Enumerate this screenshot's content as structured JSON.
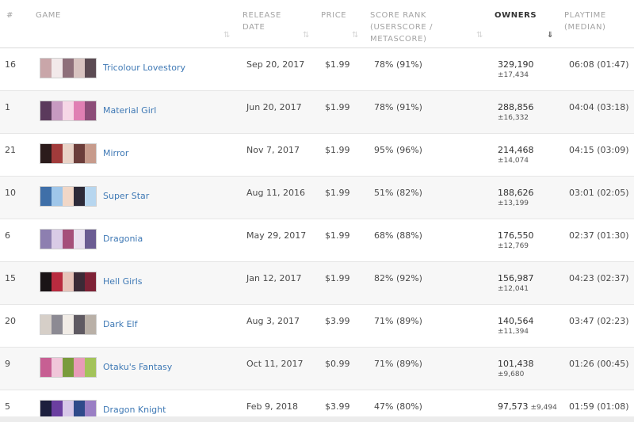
{
  "headers": {
    "num": "#",
    "game": "GAME",
    "release_1": "RELEASE",
    "release_2": "DATE",
    "price": "PRICE",
    "score_1": "SCORE RANK",
    "score_2": "(USERSCORE /",
    "score_3": "METASCORE)",
    "owners": "OWNERS",
    "playtime_1": "PLAYTIME",
    "playtime_2": "(MEDIAN)"
  },
  "icons": {
    "sort": "sort-arrows-icon",
    "sort_active": "sort-desc-icon",
    "sort_glyph": "⇅",
    "sort_active_glyph": "⇓"
  },
  "rows": [
    {
      "num": "16",
      "name": "Tricolour Lovestory",
      "date": "Sep 20, 2017",
      "price": "$1.99",
      "score": "78% (91%)",
      "owners": "329,190",
      "err": "±17,434",
      "play": "06:08 (01:47)",
      "thumb": [
        "#c9a6a9",
        "#f2e9ea",
        "#8e6f7a",
        "#d8c3c0",
        "#5b4a52"
      ]
    },
    {
      "num": "1",
      "name": "Material Girl",
      "date": "Jun 20, 2017",
      "price": "$1.99",
      "score": "78% (91%)",
      "owners": "288,856",
      "err": "±16,332",
      "play": "04:04 (03:18)",
      "thumb": [
        "#5b3a5c",
        "#c79ac1",
        "#f6d7e6",
        "#e07fb3",
        "#8c4d78"
      ]
    },
    {
      "num": "21",
      "name": "Mirror",
      "date": "Nov 7, 2017",
      "price": "$1.99",
      "score": "95% (96%)",
      "owners": "214,468",
      "err": "±14,074",
      "play": "04:15 (03:09)",
      "thumb": [
        "#2b1b1b",
        "#a13b3b",
        "#e9d3c7",
        "#6b3d3a",
        "#c79b8c"
      ]
    },
    {
      "num": "10",
      "name": "Super Star",
      "date": "Aug 11, 2016",
      "price": "$1.99",
      "score": "51% (82%)",
      "owners": "188,626",
      "err": "±13,199",
      "play": "03:01 (02:05)",
      "thumb": [
        "#3f6fa8",
        "#9fc6e9",
        "#f1d7c7",
        "#2d2a38",
        "#b7d6ef"
      ]
    },
    {
      "num": "6",
      "name": "Dragonia",
      "date": "May 29, 2017",
      "price": "$1.99",
      "score": "68% (88%)",
      "owners": "176,550",
      "err": "±12,769",
      "play": "02:37 (01:30)",
      "thumb": [
        "#8d7fb0",
        "#d9cbe6",
        "#a54f7a",
        "#e8dfef",
        "#6b5c92"
      ]
    },
    {
      "num": "15",
      "name": "Hell Girls",
      "date": "Jan 12, 2017",
      "price": "$1.99",
      "score": "82% (92%)",
      "owners": "156,987",
      "err": "±12,041",
      "play": "04:23 (02:37)",
      "thumb": [
        "#1a1416",
        "#b82b3f",
        "#e6c3b9",
        "#3b2a36",
        "#7e2236"
      ]
    },
    {
      "num": "20",
      "name": "Dark Elf",
      "date": "Aug 3, 2017",
      "price": "$3.99",
      "score": "71% (89%)",
      "owners": "140,564",
      "err": "±11,394",
      "play": "03:47 (02:23)",
      "thumb": [
        "#d6cfc8",
        "#8c8a93",
        "#f1ece6",
        "#5f5a62",
        "#b9b0a7"
      ]
    },
    {
      "num": "9",
      "name": "Otaku's Fantasy",
      "date": "Oct 11, 2017",
      "price": "$0.99",
      "score": "71% (89%)",
      "owners": "101,438",
      "err": "±9,680",
      "play": "01:26 (00:45)",
      "thumb": [
        "#c75f93",
        "#f0c6d9",
        "#7a9b3c",
        "#e89bb8",
        "#a3c35a"
      ]
    },
    {
      "num": "5",
      "name": "Dragon Knight",
      "date": "Feb 9, 2018",
      "price": "$3.99",
      "score": "47% (80%)",
      "owners": "97,573",
      "err": "±9,494",
      "play": "01:59 (01:08)",
      "thumb": [
        "#1c1f3d",
        "#6b3fa0",
        "#d7c7e8",
        "#2f4a8a",
        "#9a7fc4"
      ]
    }
  ]
}
